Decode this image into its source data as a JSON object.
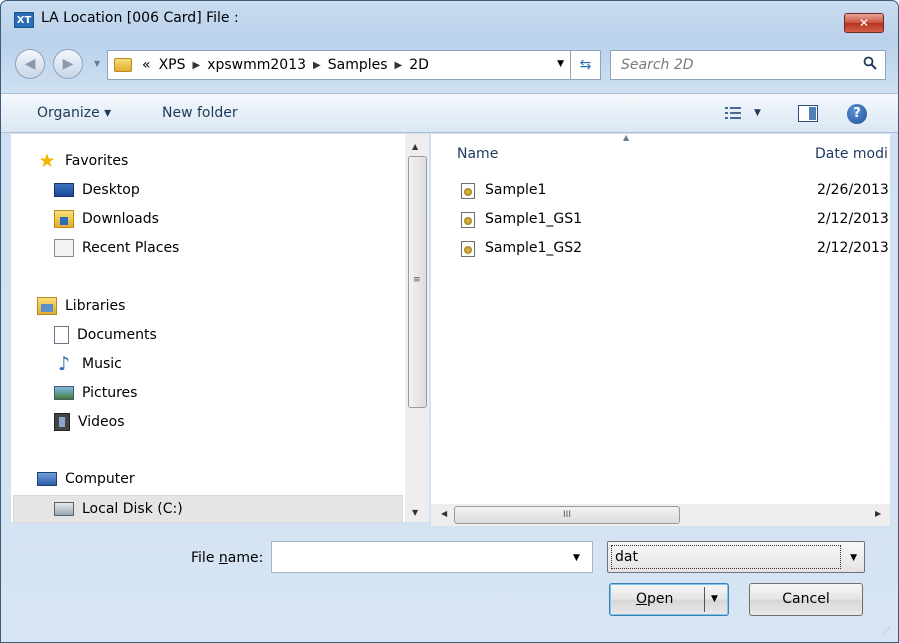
{
  "window": {
    "app_icon_text": "XT",
    "title": "LA Location [006 Card] File :",
    "close_glyph": "✕"
  },
  "address_bar": {
    "back_glyph": "◀",
    "forward_glyph": "▶",
    "overflow": "«",
    "crumbs": [
      "XPS",
      "xpswmm2013",
      "Samples",
      "2D"
    ],
    "separator": "▶"
  },
  "search": {
    "placeholder": "Search 2D"
  },
  "toolbar": {
    "organize_label": "Organize ▾",
    "new_folder_label": "New folder"
  },
  "nav_pane": {
    "items": [
      {
        "label": "Favorites",
        "icon": "star-icon"
      },
      {
        "label": "Desktop",
        "icon": "desktop-icon"
      },
      {
        "label": "Downloads",
        "icon": "downloads-icon"
      },
      {
        "label": "Recent Places",
        "icon": "recent-places-icon"
      },
      {
        "label": "Libraries",
        "icon": "libraries-icon"
      },
      {
        "label": "Documents",
        "icon": "documents-icon"
      },
      {
        "label": "Music",
        "icon": "music-icon"
      },
      {
        "label": "Pictures",
        "icon": "pictures-icon"
      },
      {
        "label": "Videos",
        "icon": "videos-icon"
      },
      {
        "label": "Computer",
        "icon": "computer-icon"
      },
      {
        "label": "Local Disk (C:)",
        "icon": "local-disk-icon",
        "selected": true
      }
    ],
    "scroll_mid_glyph": "≡"
  },
  "file_list": {
    "columns": {
      "name": "Name",
      "date": "Date modi"
    },
    "files": [
      {
        "name": "Sample1",
        "date": "2/26/2013"
      },
      {
        "name": "Sample1_GS1",
        "date": "2/12/2013"
      },
      {
        "name": "Sample1_GS2",
        "date": "2/12/2013"
      }
    ],
    "hscroll_mid_glyph": "III"
  },
  "bottom": {
    "file_name_label_prefix": "File ",
    "file_name_label_accel": "n",
    "file_name_label_suffix": "ame:",
    "file_name_value": "",
    "file_type_value": "dat",
    "open_label_accel": "O",
    "open_label_rest": "pen",
    "cancel_label": "Cancel"
  },
  "colors": {
    "frame": "#b9d1ea",
    "close_button": "#c9503c",
    "accent": "#2a6fb5"
  }
}
